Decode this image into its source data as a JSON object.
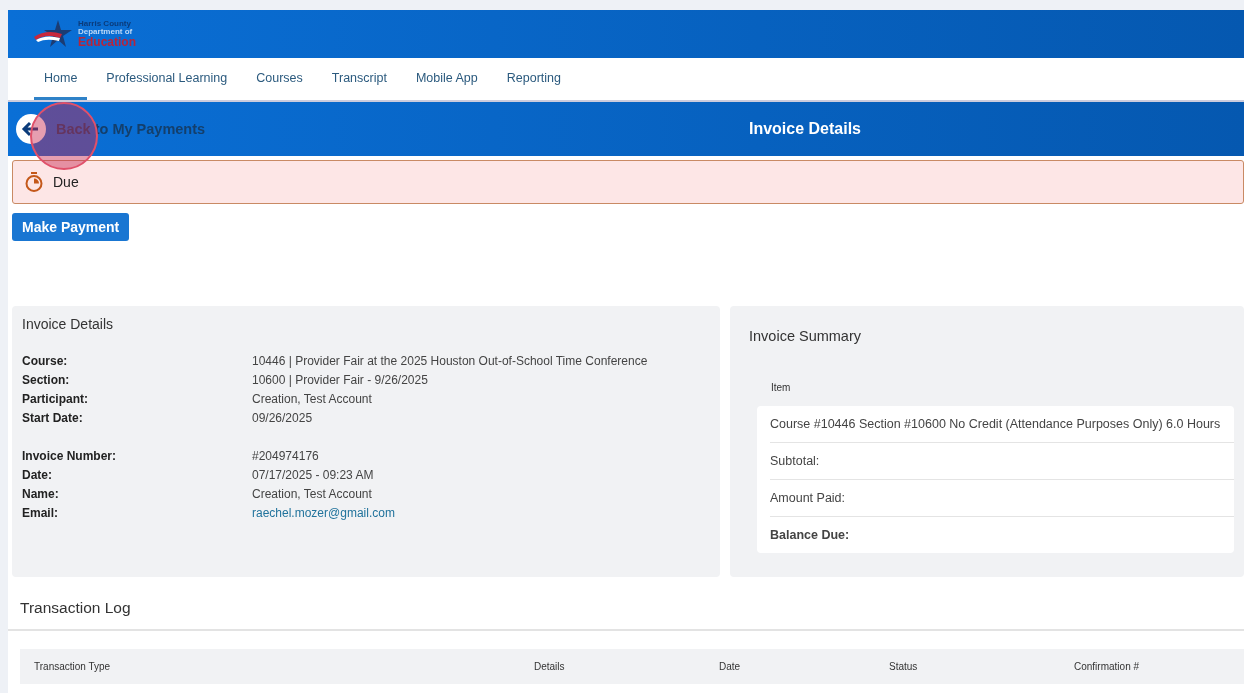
{
  "logo": {
    "lines": [
      "Harris County",
      "Department of",
      "Education"
    ]
  },
  "nav": [
    {
      "label": "Home",
      "selected": true
    },
    {
      "label": "Professional Learning",
      "selected": false
    },
    {
      "label": "Courses",
      "selected": false
    },
    {
      "label": "Transcript",
      "selected": false
    },
    {
      "label": "Mobile App",
      "selected": false
    },
    {
      "label": "Reporting",
      "selected": false
    }
  ],
  "back_bar": {
    "back_link": "Back to My Payments",
    "title": "Invoice Details"
  },
  "status_alert": {
    "label": "Due"
  },
  "make_payment_button": "Make Payment",
  "invoice_details": {
    "title": "Invoice Details",
    "groups": [
      [
        {
          "label": "Course:",
          "value": "10446 | Provider Fair at the 2025 Houston Out-of-School Time Conference",
          "kind": "text"
        },
        {
          "label": "Section:",
          "value": "10600 | Provider Fair - 9/26/2025",
          "kind": "text"
        },
        {
          "label": "Participant:",
          "value": "Creation, Test Account",
          "kind": "text"
        },
        {
          "label": "Start Date:",
          "value": "09/26/2025",
          "kind": "text"
        }
      ],
      [
        {
          "label": "Invoice Number:",
          "value": "#204974176",
          "kind": "text"
        },
        {
          "label": "Date:",
          "value": "07/17/2025 - 09:23 AM",
          "kind": "text"
        },
        {
          "label": "Name:",
          "value": "Creation, Test Account",
          "kind": "text"
        },
        {
          "label": "Email:",
          "value": "raechel.mozer@gmail.com",
          "kind": "link"
        }
      ]
    ]
  },
  "invoice_summary": {
    "title": "Invoice Summary",
    "column": "Item",
    "rows": [
      {
        "label": "Course #10446 Section #10600 No Credit (Attendance Purposes Only) 6.0 Hours",
        "bold": false
      },
      {
        "label": "Subtotal:",
        "bold": false
      },
      {
        "label": "Amount Paid:",
        "bold": false
      },
      {
        "label": "Balance Due:",
        "bold": true
      }
    ]
  },
  "transaction_log": {
    "title": "Transaction Log",
    "columns": [
      "Transaction Type",
      "Details",
      "Date",
      "Status",
      "Confirmation #"
    ]
  }
}
